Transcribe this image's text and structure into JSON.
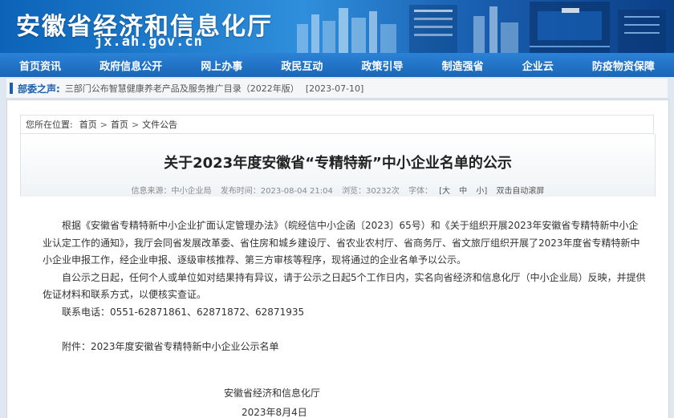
{
  "site": {
    "title": "安徽省经济和信息化厅",
    "domain": "jx.ah.gov.cn"
  },
  "nav": [
    "首页资讯",
    "政府信息公开",
    "网上办事",
    "政民互动",
    "政策引导",
    "制造强省",
    "企业云",
    "防疫物资保障"
  ],
  "ticker": {
    "label": "部委之声:",
    "text": "三部门公布智慧健康养老产品及服务推广目录（2022年版）",
    "date": "[2023-07-10]"
  },
  "breadcrumb": {
    "prefix": "您所在位置:",
    "items": [
      "首页",
      "首页",
      "文件公告"
    ]
  },
  "article": {
    "title": "关于2023年度安徽省“专精特新”中小企业名单的公示",
    "meta": {
      "source": "信息来源：中小企业局",
      "published": "发布时间：2023-08-04 21:04",
      "views": "浏览：30232次",
      "font_label": "字体：",
      "font_sizes": [
        "[大",
        "中",
        "小]"
      ],
      "autoscroll": "双击自动滚屏"
    },
    "paragraphs": [
      "根据《安徽省专精特新中小企业扩面认定管理办法》（皖经信中小企函〔2023〕65号）和《关于组织开展2023年安徽省专精特新中小企业认定工作的通知》，我厅会同省发展改革委、省住房和城乡建设厅、省农业农村厅、省商务厅、省文旅厅组织开展了2023年度省专精特新中小企业申报工作，经企业申报、逐级审核推荐、第三方审核等程序，现将通过的企业名单予以公示。",
      "自公示之日起，任何个人或单位如对结果持有异议，请于公示之日起5个工作日内，实名向省经济和信息化厅（中小企业局）反映，并提供佐证材料和联系方式，以便核实查证。",
      "联系电话：0551-62871861、62871872、62871935"
    ],
    "attachment": "附件：2023年度安徽省专精特新中小企业公示名单",
    "signature_org": "安徽省经济和信息化厅",
    "signature_date": "2023年8月4日"
  },
  "colors": {
    "nav_bg": "#1a66b8",
    "brand_blue": "#1b5fae"
  }
}
